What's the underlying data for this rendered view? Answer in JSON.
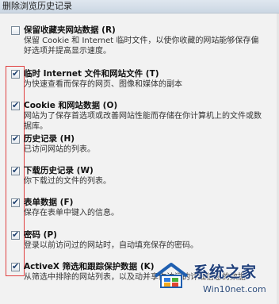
{
  "window": {
    "title": "删除浏览历史记录"
  },
  "options": [
    {
      "title": "保留收藏夹网站数据 (R)",
      "desc": "保留 Cookie 和 Internet 临时文件，以使你收藏的网站能够保存偏好选项并提高显示速度。",
      "checked": false
    },
    {
      "title": "临时 Internet 文件和网站文件 (T)",
      "desc": "为快速查看而保存的网页、图像和媒体的副本",
      "checked": true
    },
    {
      "title": "Cookie 和网站数据 (O)",
      "desc": "网站为了保存首选项或改善网站性能而存储在你计算机上的文件或数据库。",
      "checked": true
    },
    {
      "title": "历史记录 (H)",
      "desc": "已访问网站的列表。",
      "checked": true
    },
    {
      "title": "下载历史记录 (W)",
      "desc": "你下载过的文件的列表。",
      "checked": true
    },
    {
      "title": "表单数据 (F)",
      "desc": "保存在表单中键入的信息。",
      "checked": true
    },
    {
      "title": "密码 (P)",
      "desc": "登录以前访问过的网站时，自动填充保存的密码。",
      "checked": true
    },
    {
      "title": "ActiveX 筛选和跟踪保护数据 (K)",
      "desc": "从筛选中排除的网站列表，以及动并享你访问的详细信息的数据",
      "checked": true
    }
  ],
  "watermark": {
    "title": "系统之家",
    "url": "Win10net.com"
  },
  "colors": {
    "highlight_box": "#e04040",
    "checkmark": "#1d3f6e"
  }
}
